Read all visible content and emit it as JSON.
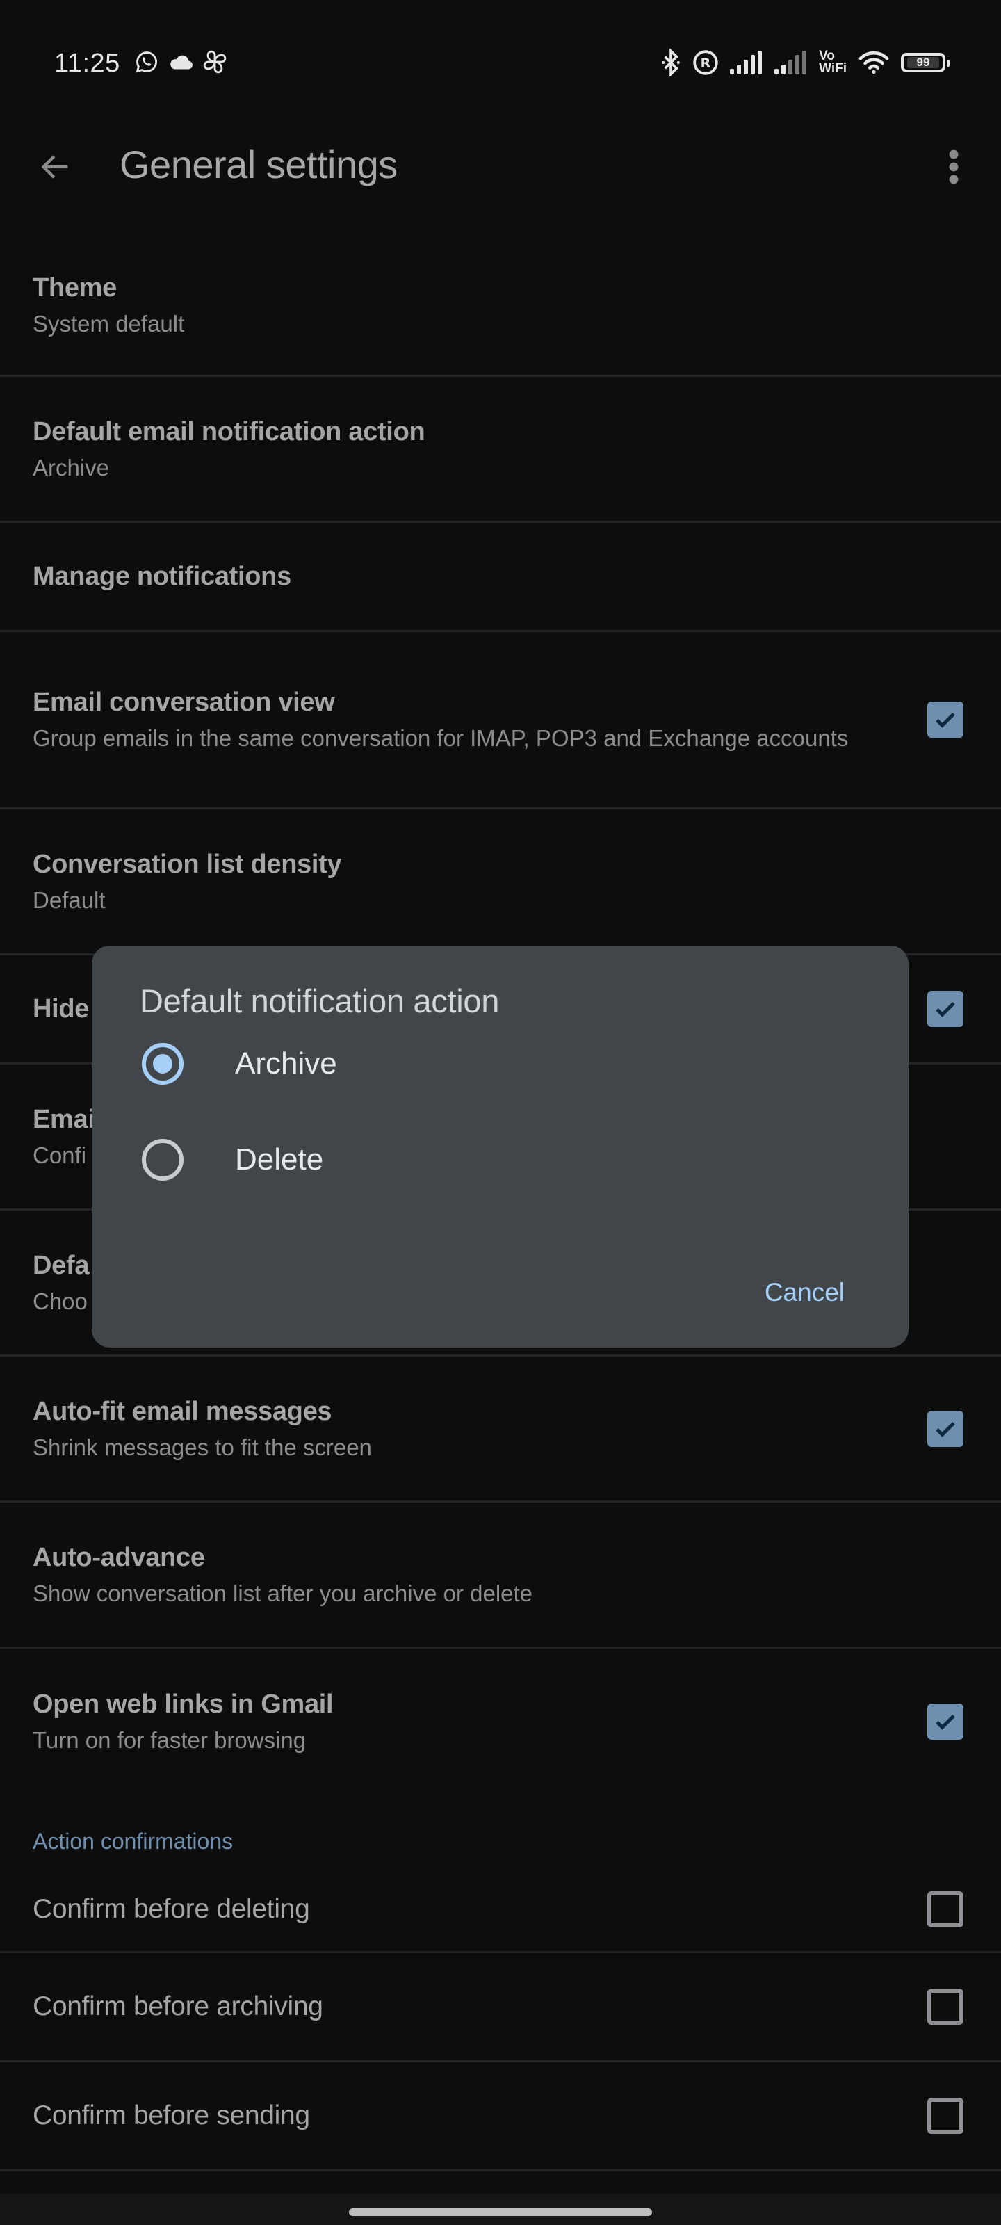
{
  "status_bar": {
    "time": "11:25",
    "left_icons": [
      "whatsapp-icon",
      "cloud-icon",
      "pinwheel-icon"
    ],
    "right_icons": [
      "bluetooth-icon",
      "registered-icon",
      "signal-sim1-icon",
      "signal-sim2-icon",
      "vowifi-icon",
      "wifi-icon",
      "battery-icon"
    ],
    "vowifi_top": "Vo",
    "vowifi_bottom": "WiFi",
    "battery_level": "99"
  },
  "app_bar": {
    "title": "General settings",
    "back_icon": "arrow-left-icon",
    "more_icon": "more-vert-icon"
  },
  "settings": [
    {
      "title": "Theme",
      "subtitle": "System default"
    },
    {
      "title": "Default email notification action",
      "subtitle": "Archive"
    },
    {
      "title": "Manage notifications"
    },
    {
      "title": "Email conversation view",
      "subtitle": "Group emails in the same conversation for IMAP, POP3 and Exchange accounts",
      "checked": true
    },
    {
      "title": "Conversation list density",
      "subtitle": "Default"
    },
    {
      "title": "Hide",
      "checked": true
    },
    {
      "title": "Emai",
      "subtitle": "Confi"
    },
    {
      "title": "Defa",
      "subtitle": "Choo"
    },
    {
      "title": "Auto-fit email messages",
      "subtitle": "Shrink messages to fit the screen",
      "checked": true
    },
    {
      "title": "Auto-advance",
      "subtitle": "Show conversation list after you archive or delete"
    },
    {
      "title": "Open web links in Gmail",
      "subtitle": "Turn on for faster browsing",
      "checked": true
    }
  ],
  "section_action_confirmations": {
    "header": "Action confirmations",
    "items": [
      {
        "title": "Confirm before deleting",
        "checked": false
      },
      {
        "title": "Confirm before archiving",
        "checked": false
      },
      {
        "title": "Confirm before sending",
        "checked": false
      }
    ]
  },
  "dialog": {
    "title": "Default notification action",
    "options": [
      {
        "label": "Archive",
        "selected": true
      },
      {
        "label": "Delete",
        "selected": false
      }
    ],
    "cancel_label": "Cancel"
  },
  "colors": {
    "background": "#0d0d0e",
    "accent": "#6f8fae",
    "dialog_bg": "#41464b",
    "dialog_accent": "#a6cff8"
  }
}
